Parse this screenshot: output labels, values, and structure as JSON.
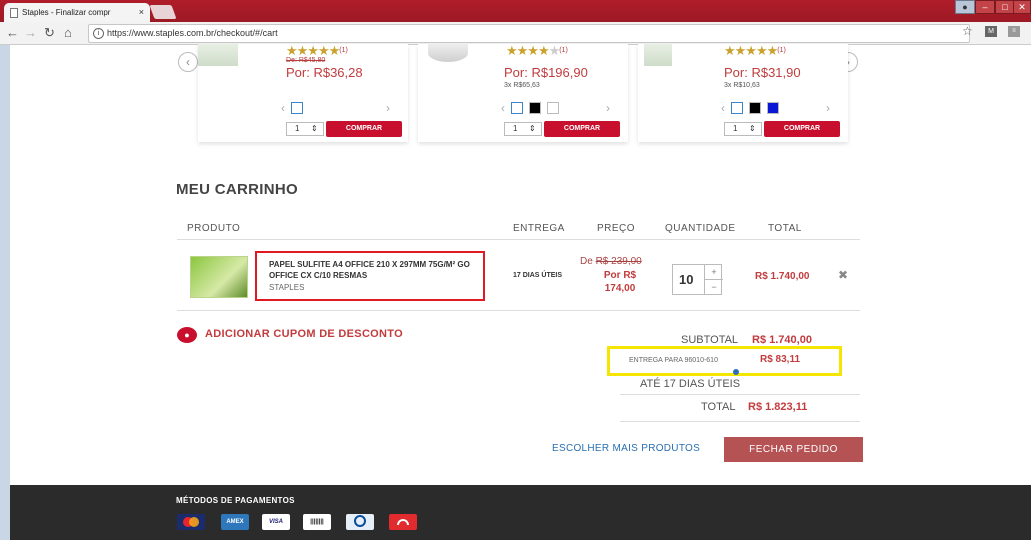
{
  "browser": {
    "tab_title": "Staples - Finalizar compr",
    "tab_close": "×",
    "url": "https://www.staples.com.br/checkout/#/cart"
  },
  "carousel": {
    "cards": [
      {
        "rating_count": "(1)",
        "old_price": "De: R$45,80",
        "price": "Por: R$36,28",
        "installments": "",
        "qty": "1",
        "buy_label": "COMPRAR"
      },
      {
        "rating_count": "(1)",
        "old_price": "",
        "price": "Por: R$196,90",
        "installments": "3x R$65,63",
        "qty": "1",
        "buy_label": "COMPRAR"
      },
      {
        "rating_count": "(1)",
        "old_price": "",
        "price": "Por: R$31,90",
        "installments": "3x R$10,63",
        "qty": "1",
        "buy_label": "COMPRAR"
      }
    ]
  },
  "cart": {
    "title": "MEU CARRINHO",
    "headers": {
      "product": "PRODUTO",
      "delivery": "ENTREGA",
      "price": "PREÇO",
      "quantity": "QUANTIDADE",
      "total": "TOTAL"
    },
    "item": {
      "name": "PAPEL SULFITE A4 OFFICE 210 X 297MM 75G/M² GO OFFICE CX C/10 RESMAS",
      "brand": "STAPLES",
      "delivery": "17 DIAS ÚTEIS",
      "price_de_label": "De",
      "price_old": "R$ 239,00",
      "price_now": "Por R$ 174,00",
      "quantity": "10",
      "total": "R$ 1.740,00"
    },
    "coupon_label": "ADICIONAR CUPOM DE DESCONTO",
    "summary": {
      "subtotal_label": "SUBTOTAL",
      "subtotal_value": "R$ 1.740,00",
      "shipping_label": "ENTREGA PARA 96010-610",
      "shipping_value": "R$ 83,11",
      "eta": "ATÉ 17 DIAS ÚTEIS",
      "total_label": "TOTAL",
      "total_value": "R$ 1.823,11"
    },
    "more_products": "ESCOLHER MAIS PRODUTOS",
    "checkout_button": "FECHAR PEDIDO"
  },
  "footer": {
    "payments_title": "MÉTODOS DE PAGAMENTOS",
    "payment_methods": [
      "mastercard",
      "american-express",
      "VISA",
      "boleto",
      "diners-club",
      "hipercard"
    ]
  },
  "colors": {
    "brand_red": "#c8102e",
    "price_red": "#c23b3d",
    "highlight_red": "#e01a22",
    "highlight_yellow": "#f5e600",
    "link_blue": "#2a6fb3"
  }
}
